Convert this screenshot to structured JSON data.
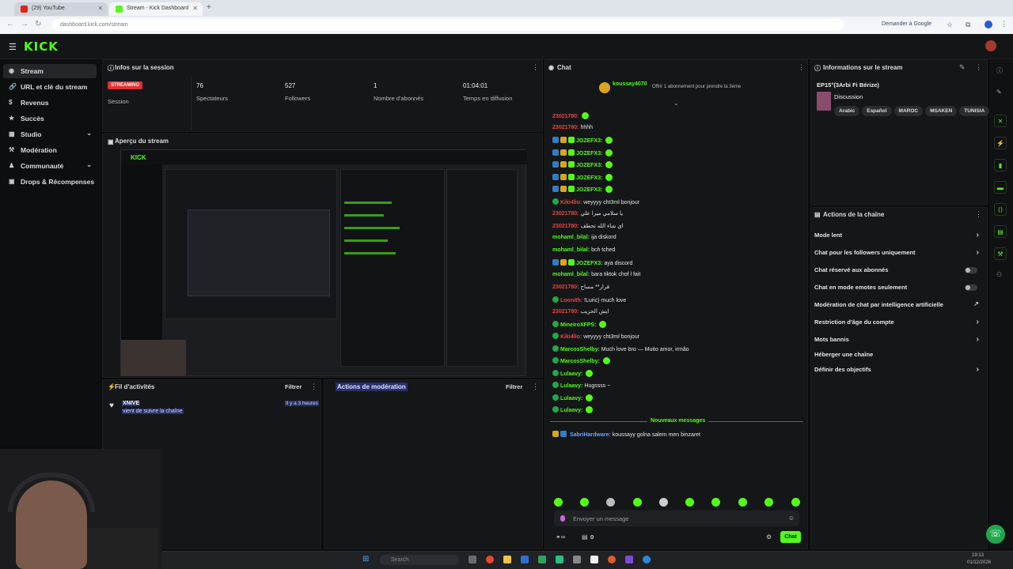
{
  "browser": {
    "tabs": [
      {
        "label": "(29) YouTube"
      },
      {
        "label": "Stream - Kick Dashboard"
      }
    ],
    "url": "dashboard.kick.com/stream",
    "translate_label": "Demander à Google"
  },
  "brand": {
    "logo": "KICK",
    "accent": "#53fc18"
  },
  "sidebar": {
    "items": [
      {
        "label": "Stream"
      },
      {
        "label": "URL et clé du stream"
      },
      {
        "label": "Revenus"
      },
      {
        "label": "Succès"
      },
      {
        "label": "Studio"
      },
      {
        "label": "Modération"
      },
      {
        "label": "Communauté"
      },
      {
        "label": "Drops & Récompenses"
      }
    ]
  },
  "session": {
    "title": "Infos sur la session",
    "live_badge": "STREAMING",
    "live_label": "Session",
    "stats": [
      {
        "value": "76",
        "label": "Spectateurs"
      },
      {
        "value": "527",
        "label": "Followers"
      },
      {
        "value": "1",
        "label": "Nombre d'abonnés"
      },
      {
        "value": "01:04:01",
        "label": "Temps en diffusion"
      }
    ]
  },
  "preview": {
    "title": "Aperçu du stream"
  },
  "activity": {
    "title": "Fil d'activités",
    "filter": "Filtrer",
    "event": {
      "user": "XNIVE",
      "text": "vient de suivre la chaîne",
      "time": "Il y a 3 heures"
    }
  },
  "moderation": {
    "title": "Actions de modération",
    "filter": "Filtrer"
  },
  "chat": {
    "title": "Chat",
    "pinned_user": "koussay4070",
    "pinned_text": "Offrir 1 abonnement pour prendre la 3ème",
    "messages": [
      {
        "user": "23021780",
        "msg": "",
        "color": "r",
        "emote": true
      },
      {
        "user": "23021780",
        "msg": "hhhh",
        "color": "r"
      },
      {
        "user": "JOZEFX3",
        "msg": "",
        "color": "g",
        "badges": true,
        "emote": true
      },
      {
        "user": "JOZEFX3",
        "msg": "",
        "color": "g",
        "badges": true,
        "emote": true
      },
      {
        "user": "JOZEFX3",
        "msg": "",
        "color": "g",
        "badges": true,
        "emote": true
      },
      {
        "user": "JOZEFX3",
        "msg": "",
        "color": "g",
        "badges": true,
        "emote": true
      },
      {
        "user": "JOZEFX3",
        "msg": "",
        "color": "g",
        "badges": true,
        "emote": true
      },
      {
        "user": "Kiki4lio",
        "msg": "weyyyy cht3ml bonjour",
        "color": "r",
        "check": true
      },
      {
        "user": "23021780",
        "msg": "يا سلامي ميرا علي",
        "color": "r"
      },
      {
        "user": "23021780",
        "msg": "اي شاء الله تحطف",
        "color": "r"
      },
      {
        "user": "mohaml_bilal",
        "msg": "ija diskord",
        "color": "g"
      },
      {
        "user": "mohaml_bilal",
        "msg": "bch tched",
        "color": "g"
      },
      {
        "user": "JOZEFX3",
        "msg": "aya discord",
        "color": "g",
        "badges": true
      },
      {
        "user": "mohaml_bilal",
        "msg": "bara tiktok chof l fait",
        "color": "g"
      },
      {
        "user": "23021780",
        "msg": "قرار** مساح",
        "color": "r"
      },
      {
        "user": "Loonith",
        "msg": "!Luric) much love",
        "color": "r",
        "check": true
      },
      {
        "user": "23021780",
        "msg": "ايش الحريب",
        "color": "r"
      },
      {
        "user": "MineiroXFPS",
        "msg": "",
        "color": "g",
        "check": true,
        "emote": true
      },
      {
        "user": "Kiki4lio",
        "msg": "weyyyy cht3ml bonjour",
        "color": "r",
        "check": true
      },
      {
        "user": "MarcosShelby",
        "msg": "Much love bro — Muito amor, irmão",
        "color": "g",
        "check": true
      },
      {
        "user": "MarcosShelby",
        "msg": "",
        "color": "g",
        "check": true,
        "emote": true
      },
      {
        "user": "Lulaavy",
        "msg": "",
        "color": "g",
        "check": true,
        "emote": true
      },
      {
        "user": "Lulaavy",
        "msg": "Hugssss ~",
        "color": "g",
        "check": true
      },
      {
        "user": "Lulaavy",
        "msg": "",
        "color": "g",
        "check": true,
        "emote": true
      },
      {
        "user": "Lulaavy",
        "msg": "",
        "color": "g",
        "check": true,
        "emote": true
      }
    ],
    "new_messages": "Nouveaux messages",
    "latest": {
      "user": "SabriHardware",
      "msg": "koussayy golna salem men binzaret"
    },
    "input_placeholder": "Envoyer un message",
    "viewer_count": "0",
    "send_label": "Chat"
  },
  "stream_info": {
    "title": "Informations sur le stream",
    "stream_title": "EP15°(3Arbi Fi Bérize)",
    "category": "Discussion",
    "tags": [
      "Arabic",
      "Español",
      "MAROC",
      "MSAKEN",
      "TUNISIA"
    ]
  },
  "channel_actions": {
    "title": "Actions de la chaîne",
    "items": [
      {
        "label": "Mode lent",
        "type": "arrow"
      },
      {
        "label": "Chat pour les followers uniquement",
        "type": "arrow"
      },
      {
        "label": "Chat réservé aux abonnés",
        "type": "toggle"
      },
      {
        "label": "Chat en mode emotes seulement",
        "type": "toggle"
      },
      {
        "label": "Modération de chat par intelligence artificielle",
        "type": "external"
      },
      {
        "label": "Restriction d'âge du compte",
        "type": "arrow"
      },
      {
        "label": "Mots bannis",
        "type": "arrow"
      },
      {
        "label": "Héberger une chaîne",
        "type": "none"
      },
      {
        "label": "Définir des objectifs",
        "type": "arrow"
      }
    ]
  },
  "taskbar": {
    "search": "Search",
    "time": "19:13",
    "date": "01/12/2026"
  }
}
